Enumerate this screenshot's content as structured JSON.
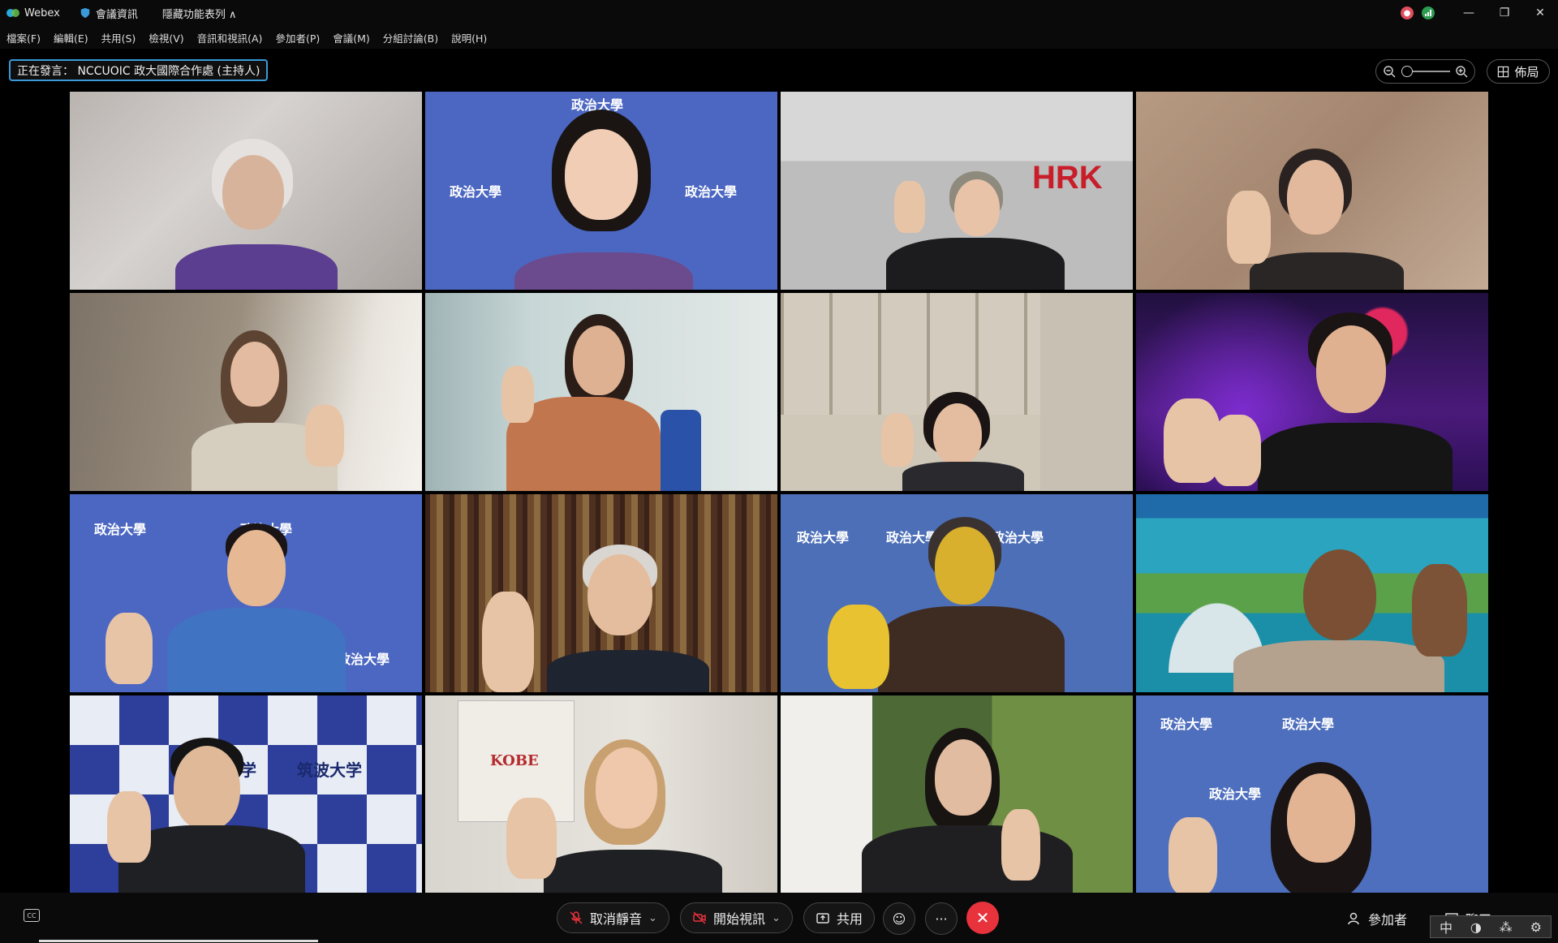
{
  "titlebar": {
    "app_name": "Webex",
    "meeting_info": "會議資訊",
    "hidden_features": "隱藏功能表列 ∧"
  },
  "menu": [
    {
      "label": "檔案(F)"
    },
    {
      "label": "編輯(E)"
    },
    {
      "label": "共用(S)"
    },
    {
      "label": "檢視(V)"
    },
    {
      "label": "音訊和視訊(A)"
    },
    {
      "label": "參加者(P)"
    },
    {
      "label": "會議(M)"
    },
    {
      "label": "分組討論(B)"
    },
    {
      "label": "說明(H)"
    }
  ],
  "speaking": "正在發言： NCCUOIC 政大國際合作處 (主持人)",
  "layout_button": "佈局",
  "zoom_level": 0.0,
  "tiles": [
    {
      "banner": ""
    },
    {
      "banner": "政治大學"
    },
    {
      "banner": "HRK"
    },
    {
      "banner": ""
    },
    {
      "banner": ""
    },
    {
      "banner": ""
    },
    {
      "banner": ""
    },
    {
      "banner": ""
    },
    {
      "banner": "政治大學"
    },
    {
      "banner": ""
    },
    {
      "banner": "政治大學"
    },
    {
      "banner": ""
    },
    {
      "banner": "筑波大学"
    },
    {
      "banner": "KOBE"
    },
    {
      "banner": ""
    },
    {
      "banner": "政治大學"
    }
  ],
  "controls": {
    "unmute": "取消靜音",
    "start_video": "開始視訊",
    "share": "共用",
    "participants": "參加者",
    "chat": "聊天"
  },
  "ime": {
    "lang": "中"
  }
}
